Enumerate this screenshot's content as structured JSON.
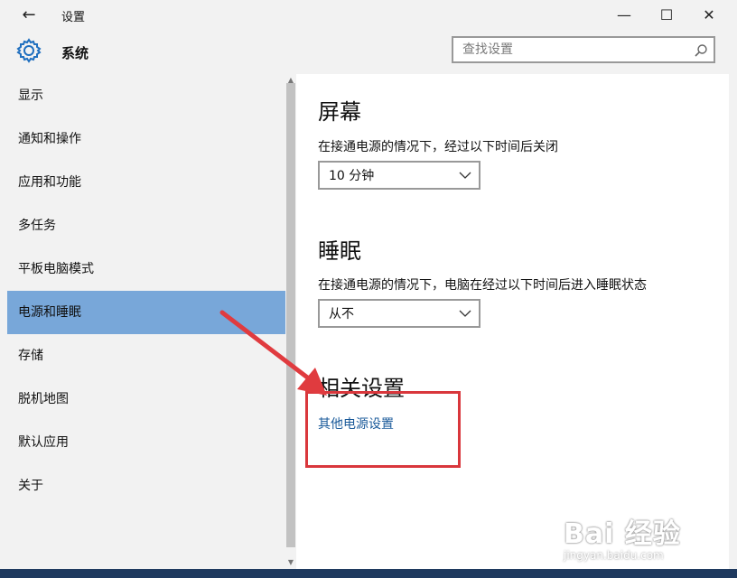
{
  "window": {
    "back_label": "←",
    "title": "设置",
    "minimize_label": "—",
    "maximize_label": "☐",
    "close_label": "✕"
  },
  "header": {
    "icon": "gear-icon",
    "section_title": "系统",
    "search": {
      "value": "",
      "placeholder": "查找设置",
      "icon": "search-icon"
    }
  },
  "sidebar": {
    "active_index": 5,
    "items": [
      {
        "label": "显示"
      },
      {
        "label": "通知和操作"
      },
      {
        "label": "应用和功能"
      },
      {
        "label": "多任务"
      },
      {
        "label": "平板电脑模式"
      },
      {
        "label": "电源和睡眠"
      },
      {
        "label": "存储"
      },
      {
        "label": "脱机地图"
      },
      {
        "label": "默认应用"
      },
      {
        "label": "关于"
      }
    ]
  },
  "content": {
    "screen": {
      "heading": "屏幕",
      "description": "在接通电源的情况下，经过以下时间后关闭",
      "selected": "10 分钟"
    },
    "sleep": {
      "heading": "睡眠",
      "description": "在接通电源的情况下，电脑在经过以下时间后进入睡眠状态",
      "selected": "从不"
    },
    "related": {
      "heading": "相关设置",
      "link": "其他电源设置"
    }
  },
  "annotation": {
    "color": "#d9373c"
  },
  "watermark": {
    "logo": "Bai 经验",
    "site": "jingyan.baidu.com"
  },
  "colors": {
    "accent": "#78a7d9",
    "link": "#1a5a9a"
  }
}
